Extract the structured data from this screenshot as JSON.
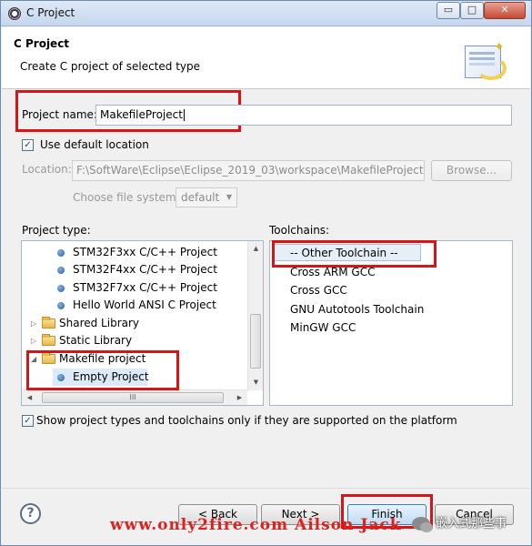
{
  "window": {
    "title": "C Project",
    "minimize_glyph": "▭",
    "maximize_glyph": "□",
    "close_glyph": "✕"
  },
  "header": {
    "title": "C Project",
    "description": "Create C project of selected type",
    "icon": "new-project-wizard-icon"
  },
  "project_name": {
    "label": "Project name:",
    "value": "MakefileProject"
  },
  "location": {
    "use_default_label": "Use default location",
    "use_default_checked": true,
    "label": "Location:",
    "value": "F:\\SoftWare\\Eclipse\\Eclipse_2019_03\\workspace\\MakefileProject",
    "browse_label": "Browse...",
    "file_system_label": "Choose file system:",
    "file_system_value": "default"
  },
  "project_type": {
    "label": "Project type:",
    "items": [
      {
        "label": "STM32F3xx C/C++ Project",
        "kind": "leaf"
      },
      {
        "label": "STM32F4xx C/C++ Project",
        "kind": "leaf"
      },
      {
        "label": "STM32F7xx C/C++ Project",
        "kind": "leaf"
      },
      {
        "label": "Hello World ANSI C Project",
        "kind": "leaf"
      },
      {
        "label": "Shared Library",
        "kind": "folder",
        "expanded": false
      },
      {
        "label": "Static Library",
        "kind": "folder",
        "expanded": false
      },
      {
        "label": "Makefile project",
        "kind": "folder",
        "expanded": true
      },
      {
        "label": "Empty Project",
        "kind": "leaf",
        "selected": true
      }
    ],
    "hscroll_thumb_glyph": "III"
  },
  "toolchains": {
    "label": "Toolchains:",
    "items": [
      {
        "label": "-- Other Toolchain --",
        "selected": true
      },
      {
        "label": "Cross ARM GCC"
      },
      {
        "label": "Cross GCC"
      },
      {
        "label": "GNU Autotools Toolchain"
      },
      {
        "label": "MinGW GCC"
      }
    ]
  },
  "filter": {
    "label": "Show project types and toolchains only if they are supported on the platform",
    "checked": true
  },
  "buttons": {
    "help_glyph": "?",
    "back": "< Back",
    "next": "Next >",
    "finish": "Finish",
    "cancel": "Cancel"
  },
  "overlay": {
    "watermark": "www.only2fire.com Ailson Jack",
    "wechat_account": "嵌入式那些事"
  },
  "colors": {
    "highlight_box": "#d91414",
    "selection": "#dceaf8",
    "watermark": "#e0201c"
  }
}
